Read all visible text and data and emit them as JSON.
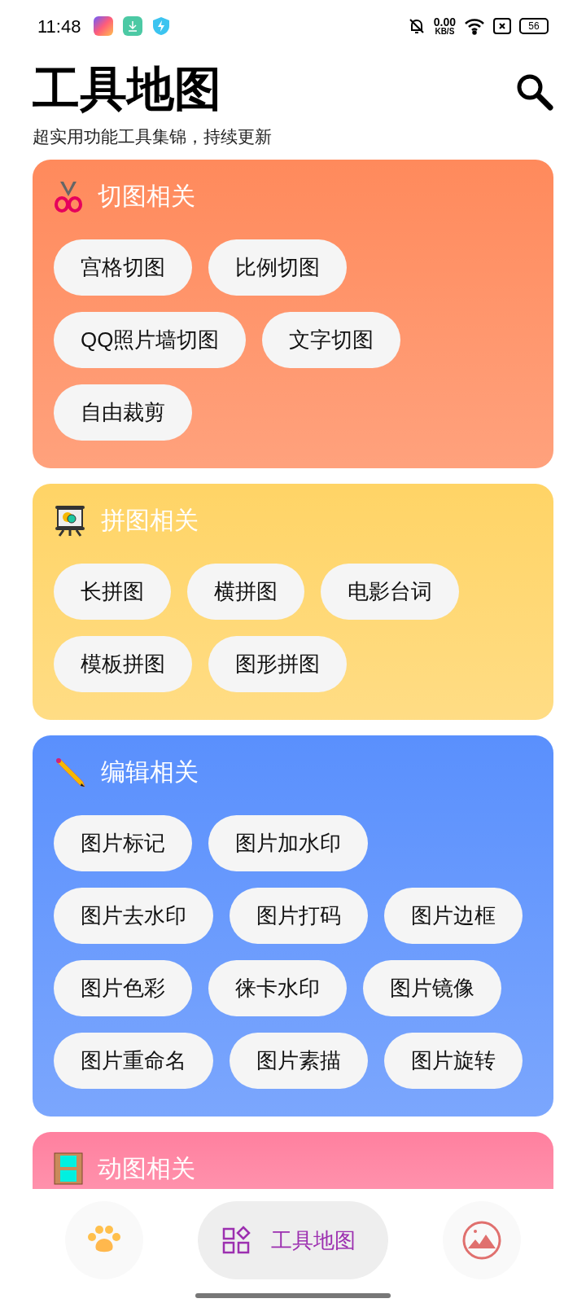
{
  "status_bar": {
    "time": "11:48",
    "speed": "0.00",
    "speed_unit": "KB/S",
    "battery": "56"
  },
  "header": {
    "title": "工具地图",
    "subtitle": "超实用功能工具集锦，持续更新"
  },
  "sections": [
    {
      "title": "切图相关",
      "kind": "scissors",
      "color": "#ff8a5c",
      "tools": [
        "宫格切图",
        "比例切图",
        "QQ照片墙切图",
        "文字切图",
        "自由裁剪"
      ]
    },
    {
      "title": "拼图相关",
      "kind": "easel",
      "color": "#ffd466",
      "tools": [
        "长拼图",
        "横拼图",
        "电影台词",
        "模板拼图",
        "图形拼图"
      ]
    },
    {
      "title": "编辑相关",
      "kind": "pencil",
      "color": "#5a90fd",
      "tools": [
        "图片标记",
        "图片加水印",
        "图片去水印",
        "图片打码",
        "图片边框",
        "图片色彩",
        "徕卡水印",
        "图片镜像",
        "图片重命名",
        "图片素描",
        "图片旋转"
      ]
    },
    {
      "title": "动图相关",
      "kind": "film",
      "color": "#ff809f"
    }
  ],
  "nav": [
    {
      "kind": "paw",
      "selected": false
    },
    {
      "kind": "grid",
      "label": "工具地图",
      "selected": true
    },
    {
      "kind": "image",
      "selected": false
    }
  ]
}
